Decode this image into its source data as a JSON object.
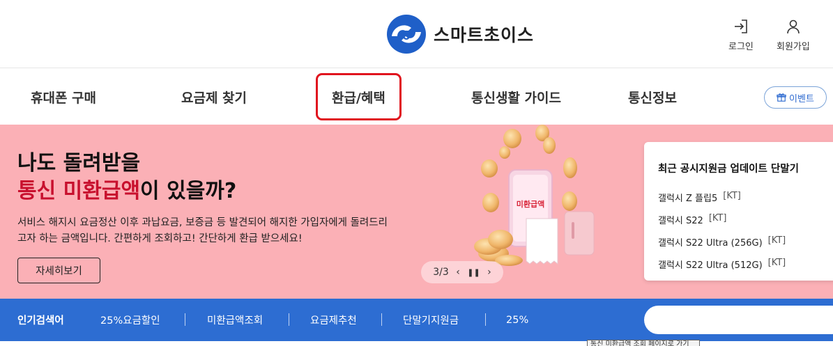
{
  "header": {
    "logo_text": "스마트초이스",
    "login_label": "로그인",
    "signup_label": "회원가입"
  },
  "nav": {
    "items": [
      {
        "label": "휴대폰 구매"
      },
      {
        "label": "요금제 찾기"
      },
      {
        "label": "환급/혜택"
      },
      {
        "label": "통신생활 가이드"
      },
      {
        "label": "통신정보"
      }
    ],
    "event_label": "이벤트"
  },
  "banner": {
    "headline_line1": "나도 돌려받을",
    "headline_highlight": "통신 미환급액",
    "headline_rest": "이 있을까?",
    "description": "서비스 해지시 요금정산 이후 과납요금, 보증금 등 발견되어 해지한 가입자에게 돌려드리고자 하는 금액입니다. 간편하게 조회하고! 간단하게 환급 받으세요!",
    "more_button": "자세히보기",
    "phone_label": "미환급액",
    "pager": {
      "current": "3",
      "total": "3",
      "text": "3/3"
    }
  },
  "update_card": {
    "title": "최근 공시지원금 업데이트 단말기",
    "items": [
      {
        "name": "갤럭시 Z 플립5",
        "carrier": "[KT]"
      },
      {
        "name": "갤럭시 S22",
        "carrier": "[KT]"
      },
      {
        "name": "갤럭시 S22 Ultra (256G)",
        "carrier": "[KT]"
      },
      {
        "name": "갤럭시 S22 Ultra (512G)",
        "carrier": "[KT]"
      }
    ]
  },
  "popular": {
    "label": "인기검색어",
    "items": [
      "25%요금할인",
      "미환급액조회",
      "요금제추천",
      "단말기지원금",
      "25%"
    ]
  },
  "tooltip": "통신 미환급액 조회 페이지로 가기",
  "colors": {
    "brand_blue": "#2d6dd2",
    "banner_pink": "#fbb0b6",
    "highlight_red": "#c8102e",
    "nav_highlight_border": "#e0141e"
  }
}
